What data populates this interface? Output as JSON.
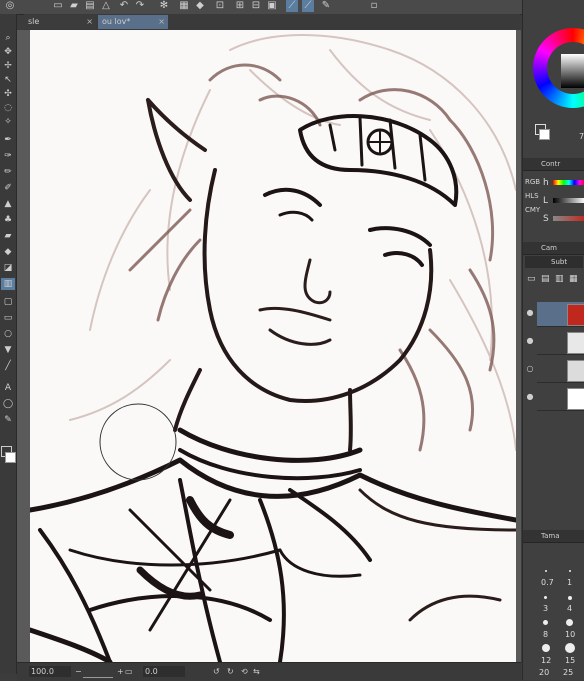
{
  "tabs": [
    {
      "label": "sle",
      "active": false
    },
    {
      "label": "ou lov*",
      "active": true
    }
  ],
  "status": {
    "zoom": "100.0",
    "angle": "0.0"
  },
  "color_panel": {
    "main_color": "#000000",
    "sub_color": "#ffffff",
    "hue_ring": "color wheel"
  },
  "color_slider": {
    "tab_label": "Contr",
    "modes": [
      "RGB",
      "HLS",
      "CMY"
    ],
    "rows": [
      {
        "letter": "h"
      },
      {
        "letter": "L"
      },
      {
        "letter": "S"
      }
    ]
  },
  "layers": {
    "header": "Cam",
    "blend_mode": "Subt",
    "rows": [
      {
        "thumb_color": "#c0281d"
      },
      {
        "thumb_color": "#e8e8e8"
      },
      {
        "thumb_color": "#dcdcdc"
      },
      {
        "thumb_color": "#ffffff"
      }
    ]
  },
  "brush_size": {
    "header": "Tama",
    "sizes": [
      "0.7",
      "1",
      "3",
      "4",
      "8",
      "10",
      "12",
      "15",
      "20",
      "25"
    ]
  },
  "topbar_num": "7"
}
